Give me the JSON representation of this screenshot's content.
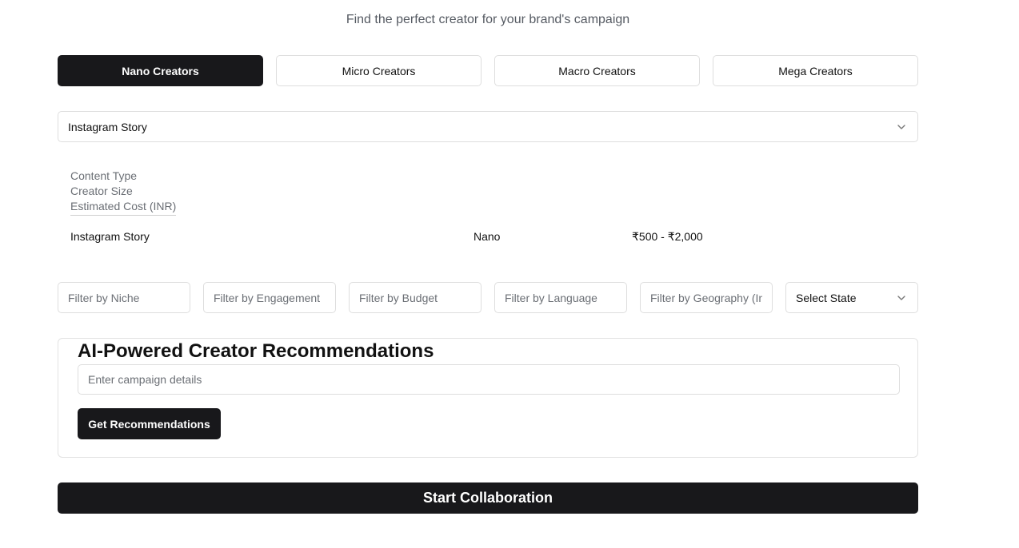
{
  "header": {
    "subtitle": "Find the perfect creator for your brand's campaign"
  },
  "tabs": [
    {
      "label": "Nano Creators",
      "active": true
    },
    {
      "label": "Micro Creators",
      "active": false
    },
    {
      "label": "Macro Creators",
      "active": false
    },
    {
      "label": "Mega Creators",
      "active": false
    }
  ],
  "content_type_select": {
    "value": "Instagram Story",
    "icon": "chevron-down-icon"
  },
  "info_table": {
    "headers": [
      "Content Type",
      "Creator Size",
      "Estimated Cost (INR)"
    ],
    "row": {
      "content_type": "Instagram Story",
      "creator_size": "Nano",
      "estimated_cost": "₹500 - ₹2,000"
    }
  },
  "filters": {
    "niche_placeholder": "Filter by Niche",
    "engagement_placeholder": "Filter by Engagement",
    "budget_placeholder": "Filter by Budget",
    "language_placeholder": "Filter by Language",
    "geography_placeholder": "Filter by Geography (India)",
    "state_select": "Select State"
  },
  "ai_section": {
    "title": "AI-Powered Creator Recommendations",
    "input_placeholder": "Enter campaign details",
    "button_label": "Get Recommendations"
  },
  "start_button": "Start Collaboration"
}
